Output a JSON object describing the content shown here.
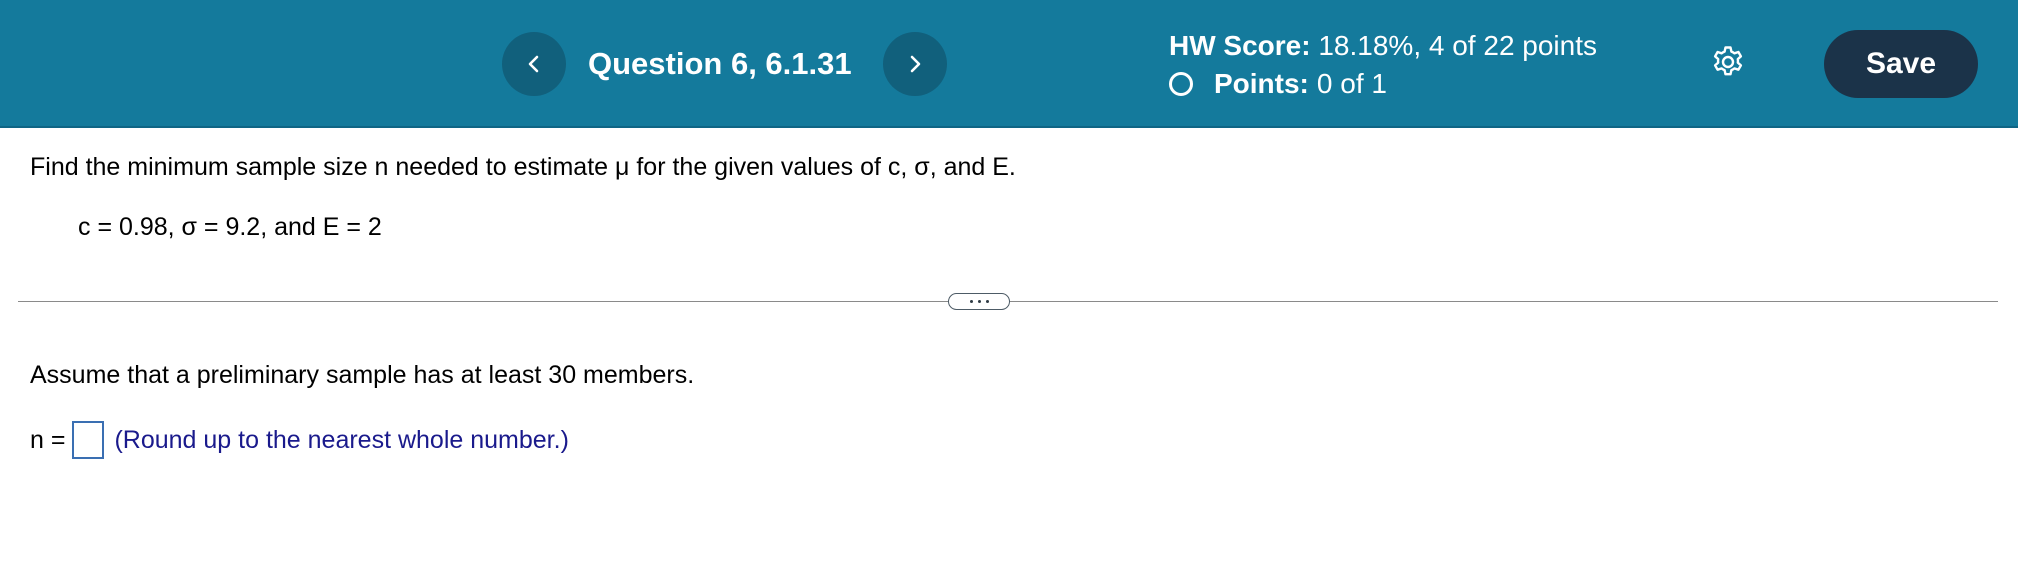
{
  "header": {
    "question_title": "Question 6, 6.1.31",
    "hw_score_label": "HW Score:",
    "hw_score_value": "18.18%, 4 of 22 points",
    "points_label": "Points:",
    "points_value": "0 of 1",
    "save_label": "Save",
    "prev_icon": "chevron-left-icon",
    "next_icon": "chevron-right-icon",
    "settings_icon": "gear-icon"
  },
  "question": {
    "prompt": "Find the minimum sample size n needed to estimate μ for the given values of c, σ, and E.",
    "given_values": "c = 0.98, σ = 9.2, and E = 2",
    "assumption": "Assume that a preliminary sample has at least 30 members.",
    "answer_label": "n =",
    "answer_value": "",
    "hint": "(Round up to the nearest whole number.)"
  },
  "colors": {
    "header_bg": "#147a9c",
    "nav_button_bg": "#11607c",
    "save_button_bg": "#1b3349",
    "hint_text": "#1a1a8c",
    "answer_box_border": "#3a6fb2"
  }
}
